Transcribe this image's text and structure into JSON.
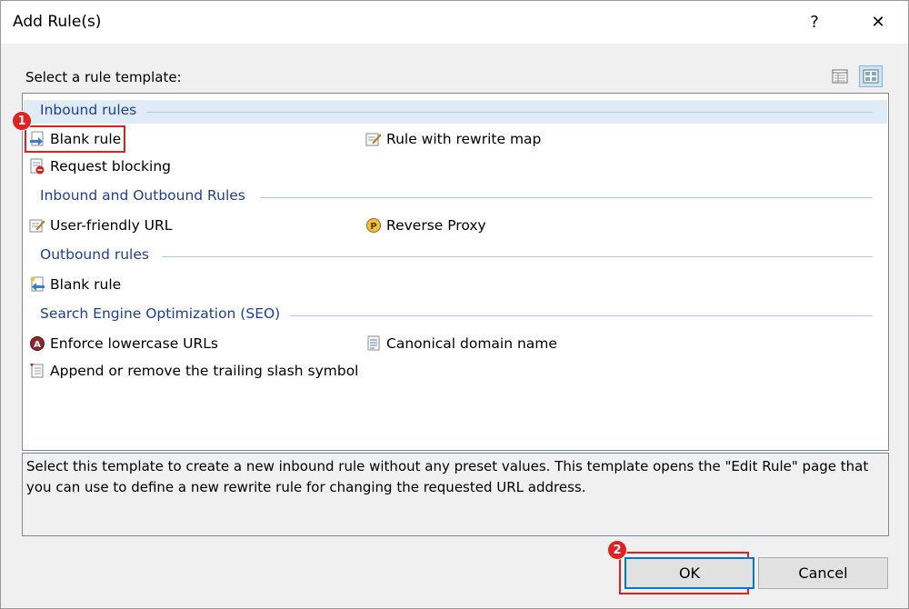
{
  "window": {
    "title": "Add Rule(s)",
    "help_glyph": "?",
    "close_glyph": "✕"
  },
  "prompt": "Select a rule template:",
  "groups": [
    {
      "label": "Inbound rules",
      "items": [
        {
          "label": "Blank rule",
          "icon": "blank-inbound-rule-icon"
        },
        {
          "label": "Rule with rewrite map",
          "icon": "rewrite-map-icon"
        },
        {
          "label": "Request blocking",
          "icon": "request-blocking-icon"
        }
      ]
    },
    {
      "label": "Inbound and Outbound Rules",
      "items": [
        {
          "label": "User-friendly URL",
          "icon": "user-friendly-url-icon"
        },
        {
          "label": "Reverse Proxy",
          "icon": "reverse-proxy-icon"
        }
      ]
    },
    {
      "label": "Outbound rules",
      "items": [
        {
          "label": "Blank rule",
          "icon": "blank-outbound-rule-icon"
        }
      ]
    },
    {
      "label": "Search Engine Optimization (SEO)",
      "items": [
        {
          "label": "Enforce lowercase URLs",
          "icon": "lowercase-url-icon"
        },
        {
          "label": "Canonical domain name",
          "icon": "canonical-domain-icon"
        },
        {
          "label": "Append or remove the trailing slash symbol",
          "icon": "trailing-slash-icon"
        }
      ]
    }
  ],
  "description": "Select this template to create a new inbound rule without any preset values. This template opens the \"Edit Rule\" page that you can use to define a new rewrite rule for changing the requested URL address.",
  "buttons": {
    "ok": "OK",
    "cancel": "Cancel"
  },
  "annotations": {
    "step1": "1",
    "step2": "2"
  },
  "colors": {
    "accent": "#0078d7",
    "highlight": "#e02020",
    "group_text": "#1e3e9e"
  }
}
